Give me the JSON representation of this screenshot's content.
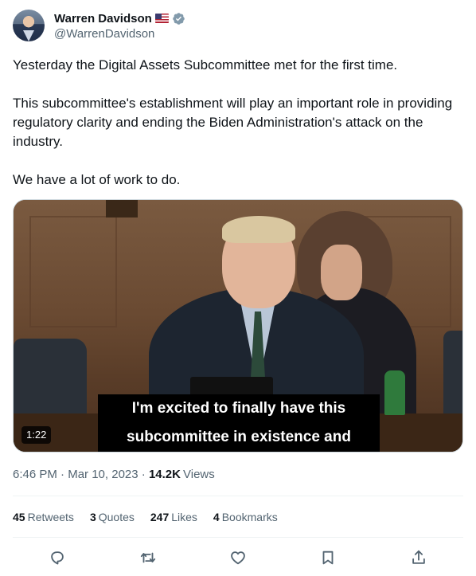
{
  "author": {
    "name": "Warren Davidson",
    "handle": "@WarrenDavidson",
    "flag_icon": "us-flag-icon",
    "verified_icon": "verified-badge-icon",
    "verified_color": "#829aab"
  },
  "tweet": {
    "text": "Yesterday the Digital Assets Subcommittee met for the first time.\n\nThis subcommittee's establishment will play an important role in providing regulatory clarity and ending the Biden Administration's attack on the industry.\n\nWe have a lot of work to do."
  },
  "video": {
    "caption_line1": "I'm excited to finally have this",
    "caption_line2": "subcommittee in existence and",
    "duration": "1:22"
  },
  "meta": {
    "time": "6:46 PM",
    "separator": " · ",
    "date": "Mar 10, 2023",
    "views_count": "14.2K",
    "views_label": "Views"
  },
  "stats": {
    "retweets_count": "45",
    "retweets_label": "Retweets",
    "quotes_count": "3",
    "quotes_label": "Quotes",
    "likes_count": "247",
    "likes_label": "Likes",
    "bookmarks_count": "4",
    "bookmarks_label": "Bookmarks"
  },
  "actions": [
    {
      "icon": "reply-icon"
    },
    {
      "icon": "retweet-icon"
    },
    {
      "icon": "like-icon"
    },
    {
      "icon": "bookmark-icon"
    },
    {
      "icon": "share-icon"
    }
  ],
  "colors": {
    "text_primary": "#0f1419",
    "text_secondary": "#536471",
    "divider": "#eff3f4"
  }
}
